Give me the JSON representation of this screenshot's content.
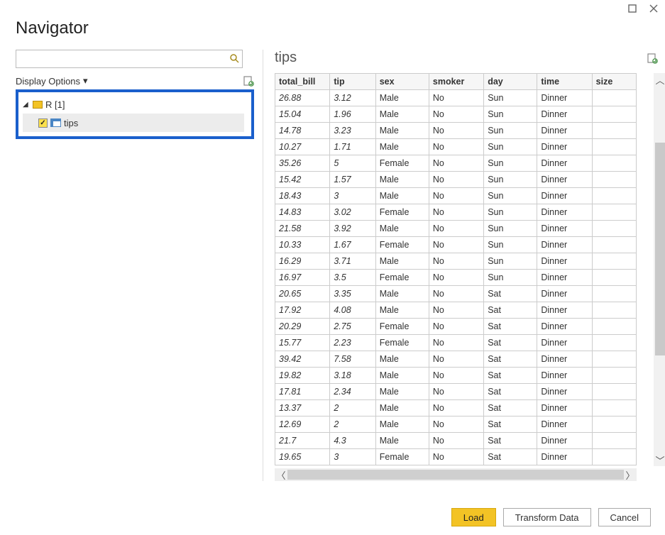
{
  "window": {
    "title": "Navigator"
  },
  "search": {
    "placeholder": ""
  },
  "displayOptions": {
    "label": "Display Options"
  },
  "tree": {
    "root": {
      "label": "R [1]"
    },
    "item": {
      "label": "tips",
      "checked": true
    }
  },
  "preview": {
    "title": "tips",
    "columns": [
      "total_bill",
      "tip",
      "sex",
      "smoker",
      "day",
      "time",
      "size"
    ],
    "rows": [
      {
        "total_bill": "26.88",
        "tip": "3.12",
        "sex": "Male",
        "smoker": "No",
        "day": "Sun",
        "time": "Dinner"
      },
      {
        "total_bill": "15.04",
        "tip": "1.96",
        "sex": "Male",
        "smoker": "No",
        "day": "Sun",
        "time": "Dinner"
      },
      {
        "total_bill": "14.78",
        "tip": "3.23",
        "sex": "Male",
        "smoker": "No",
        "day": "Sun",
        "time": "Dinner"
      },
      {
        "total_bill": "10.27",
        "tip": "1.71",
        "sex": "Male",
        "smoker": "No",
        "day": "Sun",
        "time": "Dinner"
      },
      {
        "total_bill": "35.26",
        "tip": "5",
        "sex": "Female",
        "smoker": "No",
        "day": "Sun",
        "time": "Dinner"
      },
      {
        "total_bill": "15.42",
        "tip": "1.57",
        "sex": "Male",
        "smoker": "No",
        "day": "Sun",
        "time": "Dinner"
      },
      {
        "total_bill": "18.43",
        "tip": "3",
        "sex": "Male",
        "smoker": "No",
        "day": "Sun",
        "time": "Dinner"
      },
      {
        "total_bill": "14.83",
        "tip": "3.02",
        "sex": "Female",
        "smoker": "No",
        "day": "Sun",
        "time": "Dinner"
      },
      {
        "total_bill": "21.58",
        "tip": "3.92",
        "sex": "Male",
        "smoker": "No",
        "day": "Sun",
        "time": "Dinner"
      },
      {
        "total_bill": "10.33",
        "tip": "1.67",
        "sex": "Female",
        "smoker": "No",
        "day": "Sun",
        "time": "Dinner"
      },
      {
        "total_bill": "16.29",
        "tip": "3.71",
        "sex": "Male",
        "smoker": "No",
        "day": "Sun",
        "time": "Dinner"
      },
      {
        "total_bill": "16.97",
        "tip": "3.5",
        "sex": "Female",
        "smoker": "No",
        "day": "Sun",
        "time": "Dinner"
      },
      {
        "total_bill": "20.65",
        "tip": "3.35",
        "sex": "Male",
        "smoker": "No",
        "day": "Sat",
        "time": "Dinner"
      },
      {
        "total_bill": "17.92",
        "tip": "4.08",
        "sex": "Male",
        "smoker": "No",
        "day": "Sat",
        "time": "Dinner"
      },
      {
        "total_bill": "20.29",
        "tip": "2.75",
        "sex": "Female",
        "smoker": "No",
        "day": "Sat",
        "time": "Dinner"
      },
      {
        "total_bill": "15.77",
        "tip": "2.23",
        "sex": "Female",
        "smoker": "No",
        "day": "Sat",
        "time": "Dinner"
      },
      {
        "total_bill": "39.42",
        "tip": "7.58",
        "sex": "Male",
        "smoker": "No",
        "day": "Sat",
        "time": "Dinner"
      },
      {
        "total_bill": "19.82",
        "tip": "3.18",
        "sex": "Male",
        "smoker": "No",
        "day": "Sat",
        "time": "Dinner"
      },
      {
        "total_bill": "17.81",
        "tip": "2.34",
        "sex": "Male",
        "smoker": "No",
        "day": "Sat",
        "time": "Dinner"
      },
      {
        "total_bill": "13.37",
        "tip": "2",
        "sex": "Male",
        "smoker": "No",
        "day": "Sat",
        "time": "Dinner"
      },
      {
        "total_bill": "12.69",
        "tip": "2",
        "sex": "Male",
        "smoker": "No",
        "day": "Sat",
        "time": "Dinner"
      },
      {
        "total_bill": "21.7",
        "tip": "4.3",
        "sex": "Male",
        "smoker": "No",
        "day": "Sat",
        "time": "Dinner"
      },
      {
        "total_bill": "19.65",
        "tip": "3",
        "sex": "Female",
        "smoker": "No",
        "day": "Sat",
        "time": "Dinner"
      }
    ]
  },
  "buttons": {
    "load": "Load",
    "transform": "Transform Data",
    "cancel": "Cancel"
  }
}
